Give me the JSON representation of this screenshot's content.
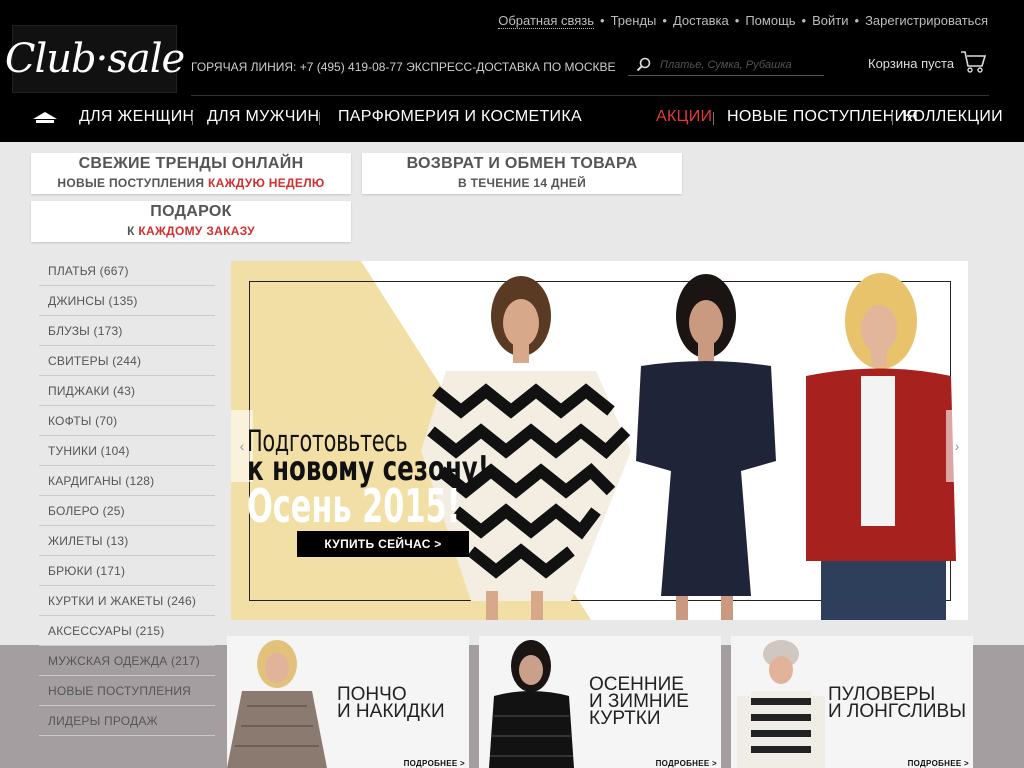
{
  "header": {
    "logo_text": "Club·sale",
    "hotline": "ГОРЯЧАЯ ЛИНИЯ: +7 (495) 419-08-77 ЭКСПРЕСС-ДОСТАВКА ПО МОСКВЕ",
    "top_links": [
      "Обратная связь",
      "Тренды",
      "Доставка",
      "Помощь",
      "Войти",
      "Зарегистрироваться"
    ],
    "link_separator": "•",
    "search_placeholder": "Платье, Сумка, Рубашка",
    "cart_label": "Корзина пуста"
  },
  "nav": {
    "women": "ДЛЯ ЖЕНЩИН",
    "men": "ДЛЯ МУЖЧИН",
    "perfume": "ПАРФЮМЕРИЯ И КОСМЕТИКА",
    "sale": "АКЦИИ",
    "new": "НОВЫЕ ПОСТУПЛЕНИЯ",
    "collections": "КОЛЛЕКЦИИ"
  },
  "promos": {
    "trends_title": "СВЕЖИЕ ТРЕНДЫ ОНЛАЙН",
    "trends_sub": "НОВЫЕ ПОСТУПЛЕНИЯ",
    "trends_sub_red": "КАЖДУЮ НЕДЕЛЮ",
    "return_title": "ВОЗВРАТ И ОБМЕН ТОВАРА",
    "return_sub": "В ТЕЧЕНИЕ 14 ДНЕЙ",
    "gift_title": "ПОДАРОК",
    "gift_sub": "К",
    "gift_sub_red": "КАЖДОМУ ЗАКАЗУ"
  },
  "sidebar": {
    "items": [
      "ПЛАТЬЯ (667)",
      "ДЖИНСЫ (135)",
      "БЛУЗЫ (173)",
      "СВИТЕРЫ (244)",
      "ПИДЖАКИ (43)",
      "КОФТЫ (70)",
      "ТУНИКИ (104)",
      "КАРДИГАНЫ (128)",
      "БОЛЕРО (25)",
      "ЖИЛЕТЫ (13)",
      "БРЮКИ (171)",
      "КУРТКИ И ЖАКЕТЫ (246)",
      "АКСЕССУАРЫ (215)",
      "МУЖСКАЯ ОДЕЖДА (217)",
      "НОВЫЕ ПОСТУПЛЕНИЯ",
      "ЛИДЕРЫ ПРОДАЖ"
    ]
  },
  "hero": {
    "line1": "Подготовьтесь",
    "line2": "к новому сезону!",
    "line3": "Осень 2015!",
    "button": "КУПИТЬ СЕЙЧАС  >",
    "prev": "‹",
    "next": "›"
  },
  "tiles": {
    "ponchos": {
      "line1": "ПОНЧО",
      "line2": "И НАКИДКИ",
      "more": "ПОДРОБНЕЕ >"
    },
    "jackets": {
      "line1": "ОСЕННИЕ",
      "line2": "И ЗИМНИЕ",
      "line3": "КУРТКИ",
      "more": "ПОДРОБНЕЕ >"
    },
    "pullovers": {
      "line1": "ПУЛОВЕРЫ",
      "line2": "И ЛОНГСЛИВЫ",
      "more": "ПОДРОБНЕЕ >"
    }
  },
  "colors": {
    "accent_red": "#d32f2f",
    "header_bg": "#000000",
    "hero_yellow": "#f2dfa6"
  }
}
